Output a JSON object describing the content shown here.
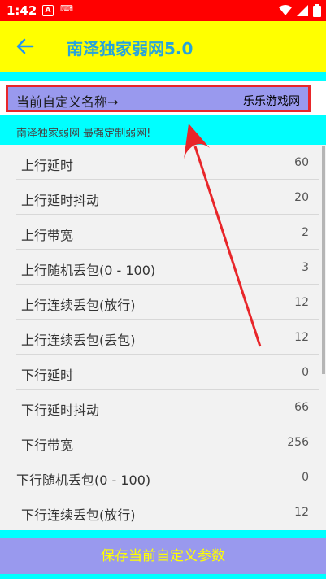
{
  "status": {
    "time": "1:42",
    "a_icon": "A",
    "kb_text": "⌨"
  },
  "header": {
    "title": "南泽独家弱网5.0"
  },
  "name_row": {
    "label": "当前自定义名称→",
    "value": "乐乐游戏网"
  },
  "banner": {
    "text": "南泽独家弱网  最强定制弱网!"
  },
  "params": [
    {
      "label": "上行延时",
      "value": "60"
    },
    {
      "label": "上行延时抖动",
      "value": "20"
    },
    {
      "label": "上行带宽",
      "value": "2"
    },
    {
      "label": "上行随机丢包(0 - 100)",
      "value": "3"
    },
    {
      "label": "上行连续丢包(放行)",
      "value": "12"
    },
    {
      "label": "上行连续丢包(丢包)",
      "value": "12"
    },
    {
      "label": "下行延时",
      "value": "0"
    },
    {
      "label": "下行延时抖动",
      "value": "66"
    },
    {
      "label": "下行带宽",
      "value": "256"
    },
    {
      "label": "下行随机丢包(0 - 100)",
      "value": "0"
    },
    {
      "label": "下行连续丢包(放行)",
      "value": "12"
    }
  ],
  "footer": {
    "save_label": "保存当前自定义参数"
  },
  "colors": {
    "status_bar": "#ff0000",
    "app_bar": "#ffff00",
    "accent_cyan": "#00ffff",
    "panel_purple": "#9999ee",
    "title_blue": "#26a3dc",
    "annotation_red": "#e8262a"
  },
  "icons": {
    "back": "back-arrow-icon",
    "wifi": "wifi-icon",
    "signal": "signal-icon",
    "battery": "battery-icon"
  }
}
